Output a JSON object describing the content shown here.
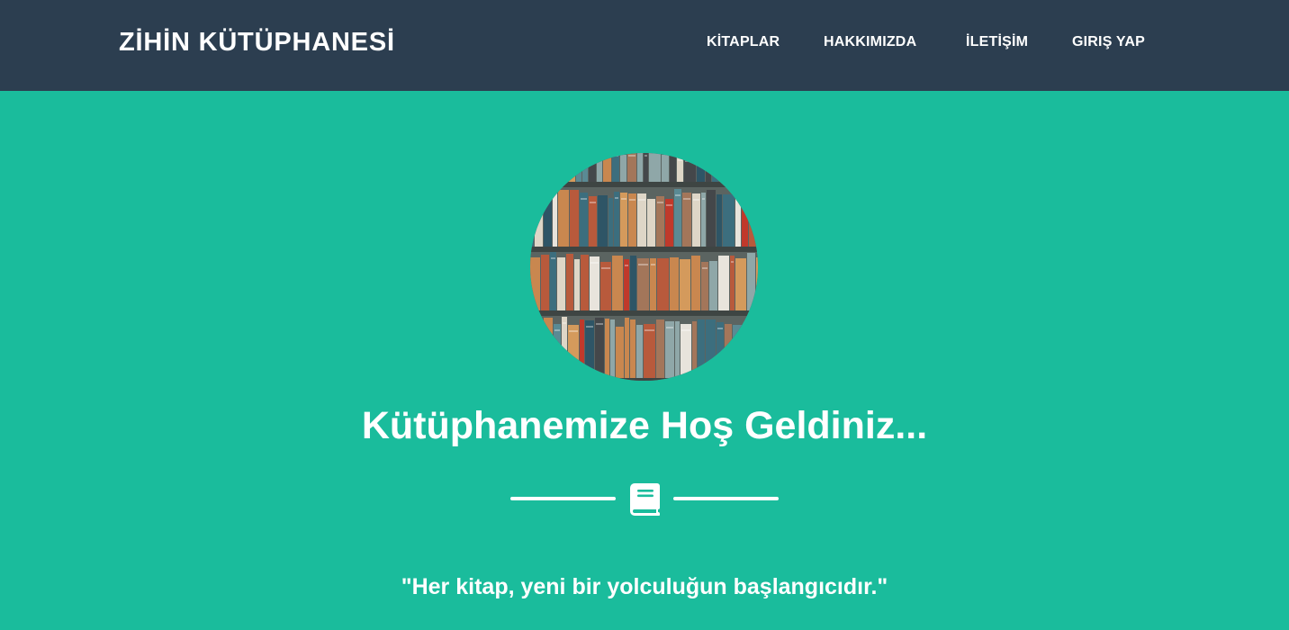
{
  "navbar": {
    "brand": "ZİHİN KÜTÜPHANESİ",
    "links": [
      {
        "label": "KİTAPLAR"
      },
      {
        "label": "HAKKIMIZDA"
      },
      {
        "label": "İLETİŞİM"
      },
      {
        "label": "GIRIŞ YAP"
      }
    ],
    "background_color": "#2c3e50"
  },
  "masthead": {
    "heading": "Kütüphanemize Hoş Geldiniz...",
    "divider_icon": "book-icon",
    "quote": "\"Her kitap, yeni bir yolculuğun başlangıcıdır.\"",
    "background_color": "#1abc9c"
  }
}
